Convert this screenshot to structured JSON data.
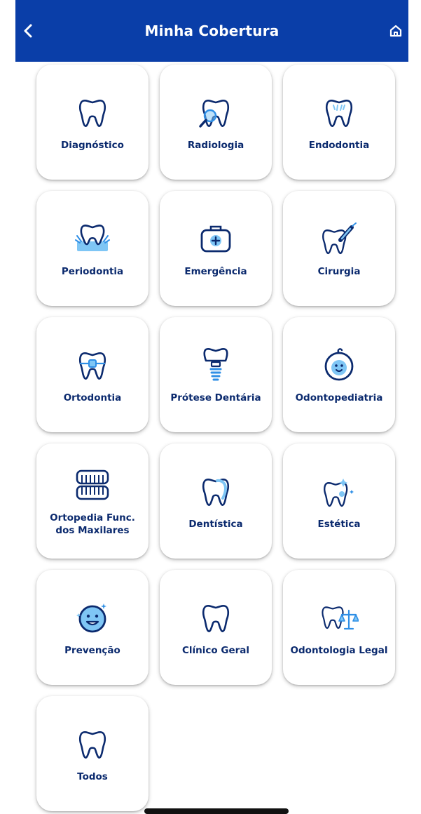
{
  "header": {
    "title": "Minha Cobertura",
    "back_icon": "chevron-left-icon",
    "home_icon": "home-icon",
    "background": "#0a3ea8"
  },
  "categories": [
    {
      "label": "Diagnóstico",
      "icon": "tooth-icon"
    },
    {
      "label": "Radiologia",
      "icon": "tooth-magnifier-icon"
    },
    {
      "label": "Endodontia",
      "icon": "tooth-roots-icon"
    },
    {
      "label": "Periodontia",
      "icon": "tooth-gum-icon"
    },
    {
      "label": "Emergência",
      "icon": "medical-kit-icon"
    },
    {
      "label": "Cirurgia",
      "icon": "tooth-scalpel-icon"
    },
    {
      "label": "Ortodontia",
      "icon": "tooth-braces-icon"
    },
    {
      "label": "Prótese Dentária",
      "icon": "tooth-implant-icon"
    },
    {
      "label": "Odontopediatria",
      "icon": "baby-face-icon"
    },
    {
      "label": "Ortopedia Func. dos Maxilares",
      "icon": "dentures-icon"
    },
    {
      "label": "Dentística",
      "icon": "tooth-restoration-icon"
    },
    {
      "label": "Estética",
      "icon": "tooth-sparkle-icon"
    },
    {
      "label": "Prevenção",
      "icon": "smile-face-icon"
    },
    {
      "label": "Clínico Geral",
      "icon": "tooth-outline-icon"
    },
    {
      "label": "Odontologia Legal",
      "icon": "tooth-scale-icon"
    },
    {
      "label": "Todos",
      "icon": "tooth-all-icon"
    }
  ],
  "colors": {
    "primary": "#0a3ea8",
    "icon_stroke": "#0b2a6e",
    "icon_accent": "#2f8fe6",
    "icon_light": "#7fc6f5",
    "label": "#0b2a6e"
  }
}
